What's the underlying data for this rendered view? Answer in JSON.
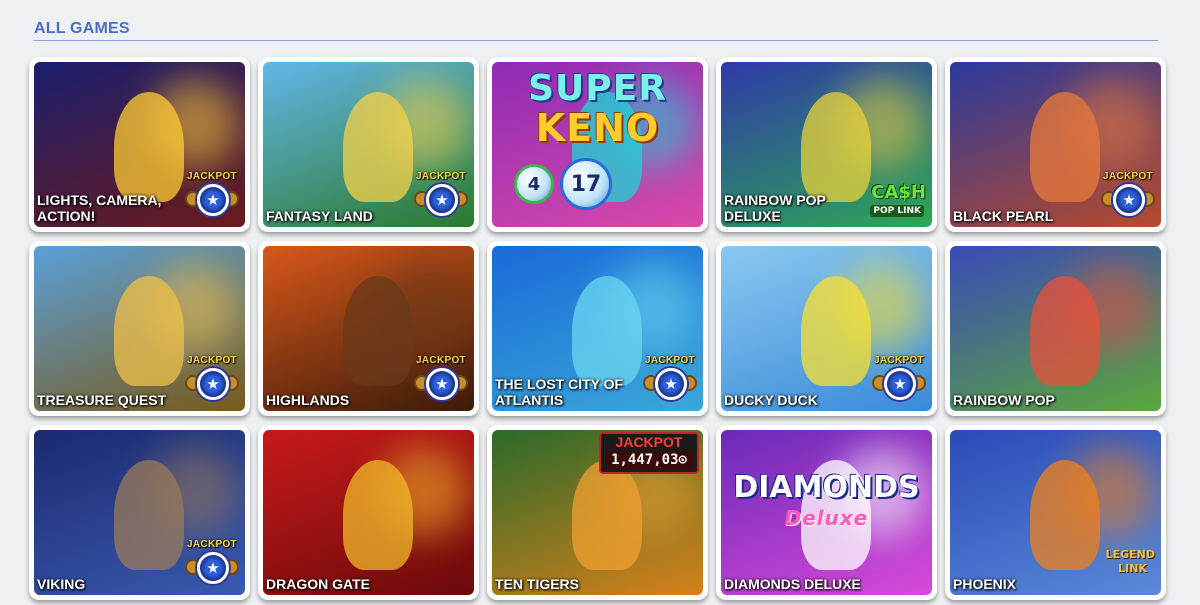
{
  "section": {
    "title": "ALL GAMES"
  },
  "games": [
    {
      "label": "LIGHTS, CAMERA, ACTION!",
      "jackpot": true,
      "bg": [
        "#1b1f6e",
        "#6a1b1b"
      ],
      "accent": "#ffcc33"
    },
    {
      "label": "FANTASY LAND",
      "jackpot": true,
      "bg": [
        "#63b6e8",
        "#2a7a2a"
      ],
      "accent": "#f4d24a"
    },
    {
      "label": "",
      "jackpot": false,
      "bg": [
        "#8e2bb5",
        "#d94aa8"
      ],
      "accent": "#1cd6d6"
    },
    {
      "label": "RAINBOW POP DELUXE",
      "jackpot": false,
      "bg": [
        "#2f3aa8",
        "#2ea854"
      ],
      "accent": "#e8d23a"
    },
    {
      "label": "BLACK PEARL",
      "jackpot": true,
      "bg": [
        "#2a3a9e",
        "#b84a2a"
      ],
      "accent": "#e87a3a"
    },
    {
      "label": "TREASURE QUEST",
      "jackpot": true,
      "bg": [
        "#5aa0d8",
        "#7a5a1a"
      ],
      "accent": "#f0c04a"
    },
    {
      "label": "HIGHLANDS",
      "jackpot": true,
      "bg": [
        "#d8581a",
        "#3a1a0a"
      ],
      "accent": "#6a3a1a"
    },
    {
      "label": "THE LOST CITY OF ATLANTIS",
      "jackpot": true,
      "bg": [
        "#1a6ad8",
        "#3aa8d8"
      ],
      "accent": "#6ad8f0"
    },
    {
      "label": "DUCKY DUCK",
      "jackpot": true,
      "bg": [
        "#8ac8f0",
        "#3a8ad8"
      ],
      "accent": "#f8e030"
    },
    {
      "label": "RAINBOW POP",
      "jackpot": false,
      "bg": [
        "#3a4ab8",
        "#5aa83a"
      ],
      "accent": "#e8503a"
    },
    {
      "label": "VIKING",
      "jackpot": true,
      "bg": [
        "#1a2a6e",
        "#3a5ab0"
      ],
      "accent": "#9a7a5a"
    },
    {
      "label": "DRAGON GATE",
      "jackpot": false,
      "bg": [
        "#c81a1a",
        "#6a0a0a"
      ],
      "accent": "#f0b82a"
    },
    {
      "label": "TEN TIGERS",
      "jackpot": false,
      "bg": [
        "#2a6a2a",
        "#d8801a"
      ],
      "accent": "#f0a030"
    },
    {
      "label": "DIAMONDS DELUXE",
      "jackpot": false,
      "bg": [
        "#6a2ab8",
        "#d84ad8"
      ],
      "accent": "#ffffff"
    },
    {
      "label": "PHOENIX",
      "jackpot": false,
      "bg": [
        "#2a4ab8",
        "#5a8ad8"
      ],
      "accent": "#f0801a"
    }
  ],
  "jackpot_badge": "JACKPOT",
  "keno": {
    "title_top": "SUPER",
    "title_bottom": "KENO",
    "balls": [
      "4",
      "17"
    ]
  },
  "cash_link": {
    "line1": "CA$H",
    "line2": "POP LINK"
  },
  "tigers_jackpot": {
    "label": "JACKPOT",
    "amount": "1,447,03⊙"
  },
  "diamonds": {
    "title": "DIAMONDS",
    "subtitle": "Deluxe"
  },
  "phoenix_logo": {
    "line1": "LEGEND",
    "line2": "LINK"
  },
  "icons": {
    "star": "★"
  }
}
